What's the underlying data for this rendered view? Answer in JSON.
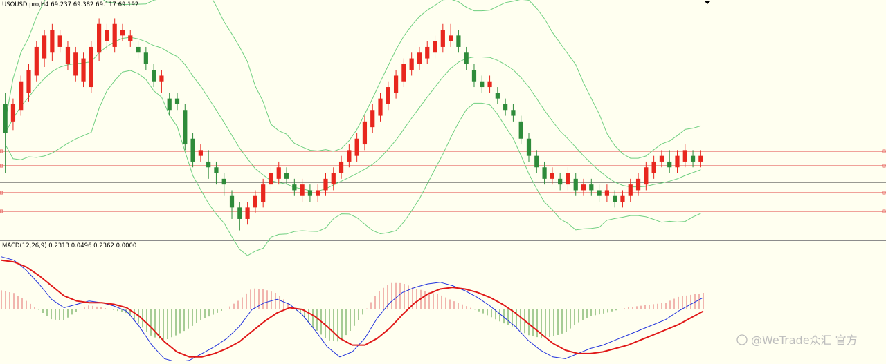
{
  "header": {
    "symbol_line": "USOUSD.pro,H4  69.237 69.382 69.117 69.192"
  },
  "macd_panel": {
    "label": "MACD(12,26,9) 0.2313 0.0496 0.2362 0.0000"
  },
  "watermark": {
    "text": "@WeTrade众汇 官方"
  },
  "colors": {
    "background": "#fffff0",
    "bull_candle": "#e8271e",
    "bear_candle": "#2e8b3a",
    "bollinger": "#6fcf80",
    "hline_red": "#e24444",
    "hline_dark": "#333333",
    "macd_line": "#2233dd",
    "signal_line": "#e01818",
    "hist_pos": "#e36b6b",
    "hist_neg": "#4c9a3a",
    "panel_border": "#8c8c8c"
  },
  "chart_data": [
    {
      "type": "candlestick",
      "title": "USOUSD.pro,H4",
      "ohlc_last": {
        "open": 69.237,
        "high": 69.382,
        "low": 69.117,
        "close": 69.192
      },
      "indicators": [
        "Bollinger Bands"
      ],
      "horizontal_levels": {
        "red": 4,
        "black": 1
      },
      "candles_shape": [
        [
          62,
          52,
          66,
          38
        ],
        [
          56,
          62,
          64,
          53
        ],
        [
          60,
          70,
          72,
          58
        ],
        [
          66,
          74,
          76,
          63
        ],
        [
          72,
          82,
          84,
          70
        ],
        [
          78,
          86,
          88,
          75
        ],
        [
          80,
          88,
          90,
          77
        ],
        [
          82,
          86,
          88,
          80
        ],
        [
          76,
          82,
          84,
          74
        ],
        [
          72,
          80,
          82,
          70
        ],
        [
          70,
          78,
          80,
          68
        ],
        [
          68,
          82,
          84,
          66
        ],
        [
          80,
          90,
          92,
          77
        ],
        [
          84,
          88,
          90,
          81
        ],
        [
          82,
          90,
          92,
          80
        ],
        [
          86,
          88,
          90,
          84
        ],
        [
          84,
          86,
          88,
          82
        ],
        [
          82,
          80,
          84,
          78
        ],
        [
          80,
          76,
          82,
          74
        ],
        [
          74,
          70,
          76,
          68
        ],
        [
          70,
          72,
          74,
          66
        ],
        [
          64,
          60,
          66,
          58
        ],
        [
          64,
          62,
          66,
          60
        ],
        [
          60,
          48,
          62,
          46
        ],
        [
          50,
          42,
          52,
          40
        ],
        [
          44,
          46,
          48,
          42
        ],
        [
          42,
          40,
          46,
          36
        ],
        [
          40,
          38,
          42,
          34
        ],
        [
          36,
          34,
          38,
          30
        ],
        [
          30,
          26,
          32,
          22
        ],
        [
          26,
          22,
          28,
          18
        ],
        [
          22,
          26,
          28,
          20
        ],
        [
          26,
          30,
          32,
          24
        ],
        [
          28,
          34,
          36,
          26
        ],
        [
          34,
          38,
          40,
          32
        ],
        [
          36,
          40,
          42,
          34
        ],
        [
          38,
          36,
          40,
          34
        ],
        [
          34,
          32,
          36,
          30
        ],
        [
          30,
          34,
          36,
          28
        ],
        [
          32,
          30,
          34,
          28
        ],
        [
          30,
          32,
          34,
          28
        ],
        [
          32,
          36,
          38,
          30
        ],
        [
          34,
          38,
          40,
          32
        ],
        [
          38,
          42,
          44,
          36
        ],
        [
          42,
          46,
          48,
          40
        ],
        [
          44,
          50,
          52,
          42
        ],
        [
          48,
          56,
          58,
          46
        ],
        [
          54,
          60,
          62,
          52
        ],
        [
          58,
          64,
          66,
          56
        ],
        [
          62,
          68,
          70,
          60
        ],
        [
          66,
          72,
          74,
          64
        ],
        [
          70,
          76,
          78,
          68
        ],
        [
          74,
          78,
          80,
          72
        ],
        [
          76,
          80,
          82,
          74
        ],
        [
          78,
          82,
          84,
          76
        ],
        [
          80,
          84,
          86,
          78
        ],
        [
          82,
          88,
          90,
          80
        ],
        [
          84,
          86,
          90,
          82
        ],
        [
          86,
          82,
          88,
          80
        ],
        [
          80,
          76,
          82,
          74
        ],
        [
          74,
          70,
          76,
          68
        ],
        [
          70,
          68,
          72,
          66
        ],
        [
          68,
          70,
          72,
          66
        ],
        [
          66,
          64,
          68,
          62
        ],
        [
          62,
          60,
          64,
          58
        ],
        [
          60,
          58,
          62,
          56
        ],
        [
          56,
          50,
          58,
          48
        ],
        [
          50,
          44,
          52,
          42
        ],
        [
          44,
          40,
          46,
          38
        ],
        [
          40,
          36,
          42,
          34
        ],
        [
          36,
          38,
          40,
          34
        ],
        [
          36,
          34,
          38,
          32
        ],
        [
          34,
          38,
          40,
          32
        ],
        [
          36,
          32,
          38,
          30
        ],
        [
          32,
          34,
          36,
          30
        ],
        [
          34,
          32,
          36,
          30
        ],
        [
          32,
          30,
          34,
          28
        ],
        [
          30,
          32,
          34,
          28
        ],
        [
          30,
          28,
          32,
          26
        ],
        [
          28,
          30,
          32,
          26
        ],
        [
          30,
          34,
          36,
          28
        ],
        [
          32,
          36,
          38,
          30
        ],
        [
          34,
          40,
          42,
          32
        ],
        [
          38,
          42,
          44,
          36
        ],
        [
          42,
          44,
          46,
          40
        ],
        [
          42,
          40,
          46,
          38
        ],
        [
          40,
          44,
          46,
          38
        ],
        [
          42,
          46,
          48,
          40
        ],
        [
          44,
          42,
          46,
          40
        ],
        [
          42,
          44,
          46,
          40
        ]
      ]
    },
    {
      "type": "line",
      "title": "MACD(12,26,9)",
      "values_printed": {
        "macd": 0.2313,
        "signal": 0.0496,
        "histogram": 0.2362,
        "extra": 0.0
      },
      "series_shape": {
        "macd": [
          0.62,
          0.58,
          0.46,
          0.3,
          0.12,
          0.02,
          0.06,
          0.1,
          0.08,
          0.04,
          -0.02,
          -0.2,
          -0.42,
          -0.58,
          -0.62,
          -0.6,
          -0.52,
          -0.44,
          -0.34,
          -0.2,
          0.0,
          0.08,
          0.12,
          0.06,
          -0.06,
          -0.24,
          -0.44,
          -0.56,
          -0.5,
          -0.34,
          -0.1,
          0.08,
          0.2,
          0.26,
          0.3,
          0.32,
          0.28,
          0.22,
          0.14,
          0.04,
          -0.08,
          -0.2,
          -0.36,
          -0.48,
          -0.56,
          -0.58,
          -0.52,
          -0.46,
          -0.42,
          -0.36,
          -0.3,
          -0.24,
          -0.18,
          -0.12,
          -0.02,
          0.06,
          0.14
        ],
        "signal": [
          0.58,
          0.56,
          0.5,
          0.4,
          0.28,
          0.16,
          0.1,
          0.08,
          0.08,
          0.06,
          0.02,
          -0.08,
          -0.22,
          -0.38,
          -0.5,
          -0.56,
          -0.56,
          -0.52,
          -0.46,
          -0.38,
          -0.26,
          -0.14,
          -0.04,
          0.02,
          0.0,
          -0.08,
          -0.2,
          -0.34,
          -0.42,
          -0.42,
          -0.34,
          -0.22,
          -0.06,
          0.08,
          0.18,
          0.24,
          0.26,
          0.24,
          0.2,
          0.14,
          0.06,
          -0.04,
          -0.16,
          -0.28,
          -0.4,
          -0.48,
          -0.52,
          -0.52,
          -0.5,
          -0.46,
          -0.42,
          -0.36,
          -0.3,
          -0.24,
          -0.18,
          -0.1,
          -0.02
        ]
      }
    }
  ]
}
